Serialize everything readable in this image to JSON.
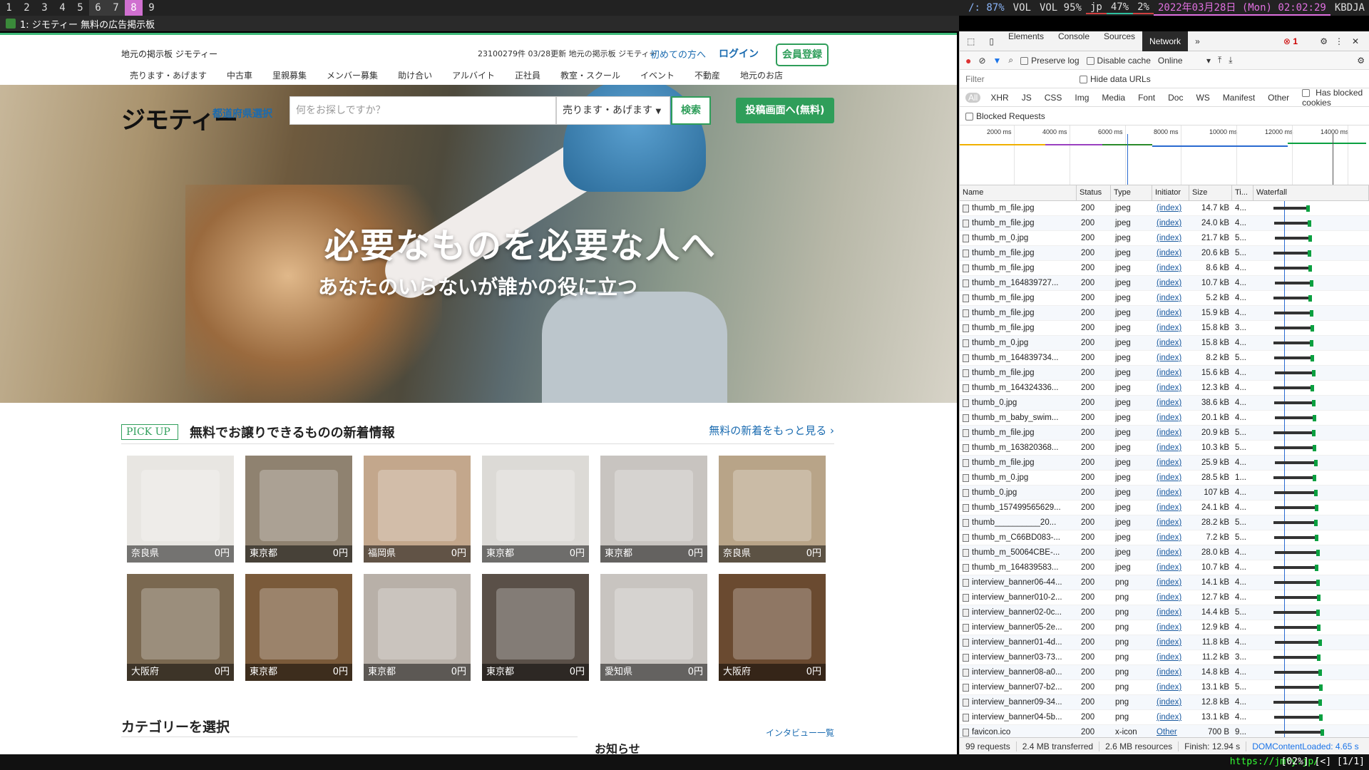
{
  "topbar": {
    "workspaces": [
      "1",
      "2",
      "3",
      "4",
      "5",
      "6",
      "7",
      "8",
      "9"
    ],
    "status": {
      "brightness": "/: 87%",
      "vol_label": "VOL",
      "vol": "VOL 95%",
      "layout": "jp",
      "cpu": "47%",
      "mem": "2%",
      "datetime": "2022年03月28日 (Mon) 02:02:29",
      "host": "KBDJA"
    }
  },
  "window_title": "1: ジモティー 無料の広告掲示板",
  "site": {
    "tagline": "地元の掲示板 ジモティー",
    "stats": "23100279件 03/28更新 地元の掲示板 ジモティー",
    "first_time": "初めての方へ",
    "login": "ログイン",
    "register": "会員登録",
    "nav": [
      "売ります・あげます",
      "中古車",
      "里親募集",
      "メンバー募集",
      "助け合い",
      "アルバイト",
      "正社員",
      "教室・スクール",
      "イベント",
      "不動産",
      "地元のお店"
    ],
    "logo": "ジモティー",
    "pref_select": "都道府県選択",
    "search_placeholder": "何をお探しですか？",
    "category_select": "売ります・あげます",
    "search_button": "検索",
    "post_button": "投稿画面へ(無料)",
    "hero_title": "必要なものを必要な人へ",
    "hero_sub": "あなたのいらないが誰かの役に立つ",
    "pickup_badge": "PICK UP",
    "pickup_title": "無料でお譲りできるものの新着情報",
    "pickup_more": "無料の新着をもっと見る ›",
    "items": [
      {
        "pref": "奈良県",
        "price": "0円",
        "color": "#e8e6e2"
      },
      {
        "pref": "東京都",
        "price": "0円",
        "color": "#8f8270"
      },
      {
        "pref": "福岡県",
        "price": "0円",
        "color": "#c3a78c"
      },
      {
        "pref": "東京都",
        "price": "0円",
        "color": "#dcdad6"
      },
      {
        "pref": "東京都",
        "price": "0円",
        "color": "#c8c4c0"
      },
      {
        "pref": "奈良県",
        "price": "0円",
        "color": "#b8a488"
      },
      {
        "pref": "大阪府",
        "price": "0円",
        "color": "#7a6850"
      },
      {
        "pref": "東京都",
        "price": "0円",
        "color": "#7a5a3a"
      },
      {
        "pref": "東京都",
        "price": "0円",
        "color": "#b8b0a8"
      },
      {
        "pref": "東京都",
        "price": "0円",
        "color": "#5a5048"
      },
      {
        "pref": "愛知県",
        "price": "0円",
        "color": "#c8c4c0"
      },
      {
        "pref": "大阪府",
        "price": "0円",
        "color": "#6a4a30"
      }
    ],
    "category_heading": "カテゴリーを選択",
    "interview_link": "インタビュー一覧",
    "notice": "お知らせ"
  },
  "devtools": {
    "tabs": [
      "Elements",
      "Console",
      "Sources",
      "Network"
    ],
    "active_tab": "Network",
    "error_count": "1",
    "preserve_log": "Preserve log",
    "disable_cache": "Disable cache",
    "throttle": "Online",
    "filter_placeholder": "Filter",
    "hide_data_urls": "Hide data URLs",
    "types": [
      "All",
      "XHR",
      "JS",
      "CSS",
      "Img",
      "Media",
      "Font",
      "Doc",
      "WS",
      "Manifest",
      "Other"
    ],
    "has_blocked": "Has blocked cookies",
    "blocked_requests": "Blocked Requests",
    "timeline_labels": [
      "2000 ms",
      "4000 ms",
      "6000 ms",
      "8000 ms",
      "10000 ms",
      "12000 ms",
      "14000 ms"
    ],
    "columns": [
      "Name",
      "Status",
      "Type",
      "Initiator",
      "Size",
      "Ti...",
      "Waterfall"
    ],
    "rows": [
      {
        "name": "thumb_m_file.jpg",
        "status": "200",
        "type": "jpeg",
        "init": "(index)",
        "size": "14.7 kB",
        "time": "4..."
      },
      {
        "name": "thumb_m_file.jpg",
        "status": "200",
        "type": "jpeg",
        "init": "(index)",
        "size": "24.0 kB",
        "time": "4..."
      },
      {
        "name": "thumb_m_0.jpg",
        "status": "200",
        "type": "jpeg",
        "init": "(index)",
        "size": "21.7 kB",
        "time": "5..."
      },
      {
        "name": "thumb_m_file.jpg",
        "status": "200",
        "type": "jpeg",
        "init": "(index)",
        "size": "20.6 kB",
        "time": "5..."
      },
      {
        "name": "thumb_m_file.jpg",
        "status": "200",
        "type": "jpeg",
        "init": "(index)",
        "size": "8.6 kB",
        "time": "4..."
      },
      {
        "name": "thumb_m_164839727...",
        "status": "200",
        "type": "jpeg",
        "init": "(index)",
        "size": "10.7 kB",
        "time": "4..."
      },
      {
        "name": "thumb_m_file.jpg",
        "status": "200",
        "type": "jpeg",
        "init": "(index)",
        "size": "5.2 kB",
        "time": "4..."
      },
      {
        "name": "thumb_m_file.jpg",
        "status": "200",
        "type": "jpeg",
        "init": "(index)",
        "size": "15.9 kB",
        "time": "4..."
      },
      {
        "name": "thumb_m_file.jpg",
        "status": "200",
        "type": "jpeg",
        "init": "(index)",
        "size": "15.8 kB",
        "time": "3..."
      },
      {
        "name": "thumb_m_0.jpg",
        "status": "200",
        "type": "jpeg",
        "init": "(index)",
        "size": "15.8 kB",
        "time": "4..."
      },
      {
        "name": "thumb_m_164839734...",
        "status": "200",
        "type": "jpeg",
        "init": "(index)",
        "size": "8.2 kB",
        "time": "5..."
      },
      {
        "name": "thumb_m_file.jpg",
        "status": "200",
        "type": "jpeg",
        "init": "(index)",
        "size": "15.6 kB",
        "time": "4..."
      },
      {
        "name": "thumb_m_164324336...",
        "status": "200",
        "type": "jpeg",
        "init": "(index)",
        "size": "12.3 kB",
        "time": "4..."
      },
      {
        "name": "thumb_0.jpg",
        "status": "200",
        "type": "jpeg",
        "init": "(index)",
        "size": "38.6 kB",
        "time": "4..."
      },
      {
        "name": "thumb_m_baby_swim...",
        "status": "200",
        "type": "jpeg",
        "init": "(index)",
        "size": "20.1 kB",
        "time": "4..."
      },
      {
        "name": "thumb_m_file.jpg",
        "status": "200",
        "type": "jpeg",
        "init": "(index)",
        "size": "20.9 kB",
        "time": "5..."
      },
      {
        "name": "thumb_m_163820368...",
        "status": "200",
        "type": "jpeg",
        "init": "(index)",
        "size": "10.3 kB",
        "time": "5..."
      },
      {
        "name": "thumb_m_file.jpg",
        "status": "200",
        "type": "jpeg",
        "init": "(index)",
        "size": "25.9 kB",
        "time": "4..."
      },
      {
        "name": "thumb_m_0.jpg",
        "status": "200",
        "type": "jpeg",
        "init": "(index)",
        "size": "28.5 kB",
        "time": "1..."
      },
      {
        "name": "thumb_0.jpg",
        "status": "200",
        "type": "jpeg",
        "init": "(index)",
        "size": "107 kB",
        "time": "4..."
      },
      {
        "name": "thumb_157499565629...",
        "status": "200",
        "type": "jpeg",
        "init": "(index)",
        "size": "24.1 kB",
        "time": "4..."
      },
      {
        "name": "thumb__________20...",
        "status": "200",
        "type": "jpeg",
        "init": "(index)",
        "size": "28.2 kB",
        "time": "5..."
      },
      {
        "name": "thumb_m_C66BD083-...",
        "status": "200",
        "type": "jpeg",
        "init": "(index)",
        "size": "7.2 kB",
        "time": "5..."
      },
      {
        "name": "thumb_m_50064CBE-...",
        "status": "200",
        "type": "jpeg",
        "init": "(index)",
        "size": "28.0 kB",
        "time": "4..."
      },
      {
        "name": "thumb_m_164839583...",
        "status": "200",
        "type": "jpeg",
        "init": "(index)",
        "size": "10.7 kB",
        "time": "4..."
      },
      {
        "name": "interview_banner06-44...",
        "status": "200",
        "type": "png",
        "init": "(index)",
        "size": "14.1 kB",
        "time": "4..."
      },
      {
        "name": "interview_banner010-2...",
        "status": "200",
        "type": "png",
        "init": "(index)",
        "size": "12.7 kB",
        "time": "4..."
      },
      {
        "name": "interview_banner02-0c...",
        "status": "200",
        "type": "png",
        "init": "(index)",
        "size": "14.4 kB",
        "time": "5..."
      },
      {
        "name": "interview_banner05-2e...",
        "status": "200",
        "type": "png",
        "init": "(index)",
        "size": "12.9 kB",
        "time": "4..."
      },
      {
        "name": "interview_banner01-4d...",
        "status": "200",
        "type": "png",
        "init": "(index)",
        "size": "11.8 kB",
        "time": "4..."
      },
      {
        "name": "interview_banner03-73...",
        "status": "200",
        "type": "png",
        "init": "(index)",
        "size": "11.2 kB",
        "time": "3..."
      },
      {
        "name": "interview_banner08-a0...",
        "status": "200",
        "type": "png",
        "init": "(index)",
        "size": "14.8 kB",
        "time": "4..."
      },
      {
        "name": "interview_banner07-b2...",
        "status": "200",
        "type": "png",
        "init": "(index)",
        "size": "13.1 kB",
        "time": "5..."
      },
      {
        "name": "interview_banner09-34...",
        "status": "200",
        "type": "png",
        "init": "(index)",
        "size": "12.8 kB",
        "time": "4..."
      },
      {
        "name": "interview_banner04-5b...",
        "status": "200",
        "type": "png",
        "init": "(index)",
        "size": "13.1 kB",
        "time": "4..."
      },
      {
        "name": "favicon.ico",
        "status": "200",
        "type": "x-icon",
        "init": "Other",
        "size": "700 B",
        "time": "9..."
      }
    ],
    "footer": {
      "requests": "99 requests",
      "transferred": "2.4 MB transferred",
      "resources": "2.6 MB resources",
      "finish": "Finish: 12.94 s",
      "dcl": "DOMContentLoaded: 4.65 s"
    }
  },
  "bottombar": {
    "url": "https://jmty.jp/",
    "pos": "[02%] [<] [1/1]"
  }
}
